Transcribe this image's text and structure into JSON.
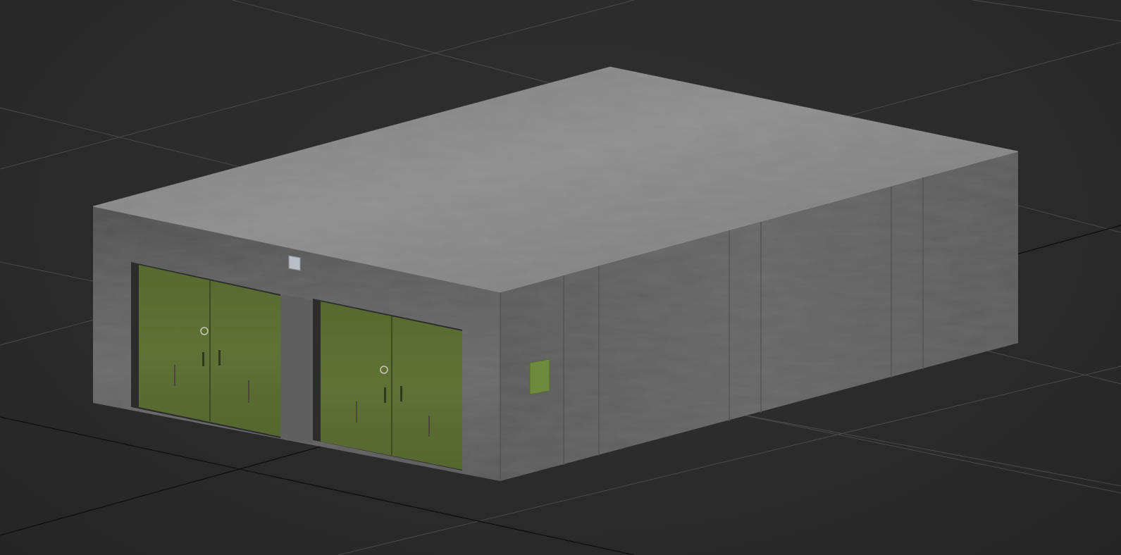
{
  "viewport": {
    "background": "#2b2b2b",
    "grid_color": "#4a4a4a",
    "grid_major_color": "#000000"
  },
  "model": {
    "wall_color": "#6b6b6b",
    "roof_color": "#8a8a8a",
    "door_color": "#5e7036",
    "panel_color": "#6e8a3e",
    "box_color": "#b9bec4",
    "garage_door_count": 2
  }
}
